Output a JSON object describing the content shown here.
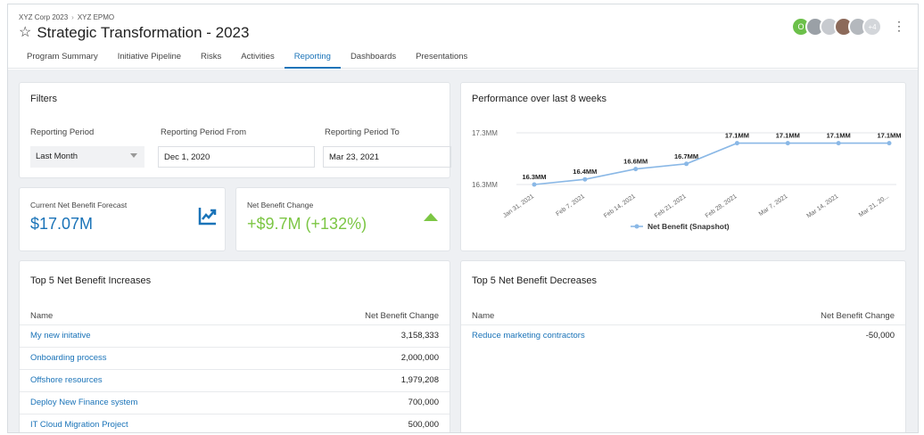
{
  "breadcrumb": {
    "org": "XYZ Corp 2023",
    "separator": "›",
    "section": "XYZ EPMO"
  },
  "page": {
    "title": "Strategic Transformation - 2023",
    "star_icon": "☆"
  },
  "tabs": [
    "Program Summary",
    "Initiative Pipeline",
    "Risks",
    "Activities",
    "Reporting",
    "Dashboards",
    "Presentations"
  ],
  "active_tab": "Reporting",
  "avatars": {
    "first_initial": "O",
    "more_label": "+4"
  },
  "filters": {
    "title": "Filters",
    "period_label": "Reporting Period",
    "period_value": "Last Month",
    "from_label": "Reporting Period From",
    "from_value": "Dec 1, 2020",
    "to_label": "Reporting Period To",
    "to_value": "Mar 23, 2021"
  },
  "kpis": {
    "forecast_label": "Current Net Benefit Forecast",
    "forecast_value": "$17.07M",
    "change_label": "Net Benefit Change",
    "change_value": "+$9.7M (+132%)",
    "change_color": "#7cc644",
    "forecast_color": "#1a73b8"
  },
  "chart_data": {
    "type": "line",
    "title": "Performance over last 8 weeks",
    "categories": [
      "Jan 31, 2021",
      "Feb 7, 2021",
      "Feb 14, 2021",
      "Feb 21, 2021",
      "Feb 28, 2021",
      "Mar 7, 2021",
      "Mar 14, 2021",
      "Mar 21, 20..."
    ],
    "series": [
      {
        "name": "Net Benefit (Snapshot)",
        "values": [
          16.3,
          16.4,
          16.6,
          16.7,
          17.1,
          17.1,
          17.1,
          17.1
        ],
        "labels": [
          "16.3MM",
          "16.4MM",
          "16.6MM",
          "16.7MM",
          "17.1MM",
          "17.1MM",
          "17.1MM",
          "17.1MM"
        ]
      }
    ],
    "y_ticks": [
      "17.3MM",
      "16.3MM"
    ],
    "ylim": [
      16.3,
      17.3
    ],
    "legend": "bottom",
    "color": "#8ab8e6"
  },
  "increases": {
    "title": "Top 5 Net Benefit Increases",
    "col_name": "Name",
    "col_value": "Net Benefit Change",
    "rows": [
      {
        "name": "My new initative",
        "value": "3,158,333"
      },
      {
        "name": "Onboarding process",
        "value": "2,000,000"
      },
      {
        "name": "Offshore resources",
        "value": "1,979,208"
      },
      {
        "name": "Deploy New Finance system",
        "value": "700,000"
      },
      {
        "name": "IT Cloud Migration Project",
        "value": "500,000"
      }
    ]
  },
  "decreases": {
    "title": "Top 5 Net Benefit Decreases",
    "col_name": "Name",
    "col_value": "Net Benefit Change",
    "rows": [
      {
        "name": "Reduce marketing contractors",
        "value": "-50,000"
      }
    ]
  }
}
